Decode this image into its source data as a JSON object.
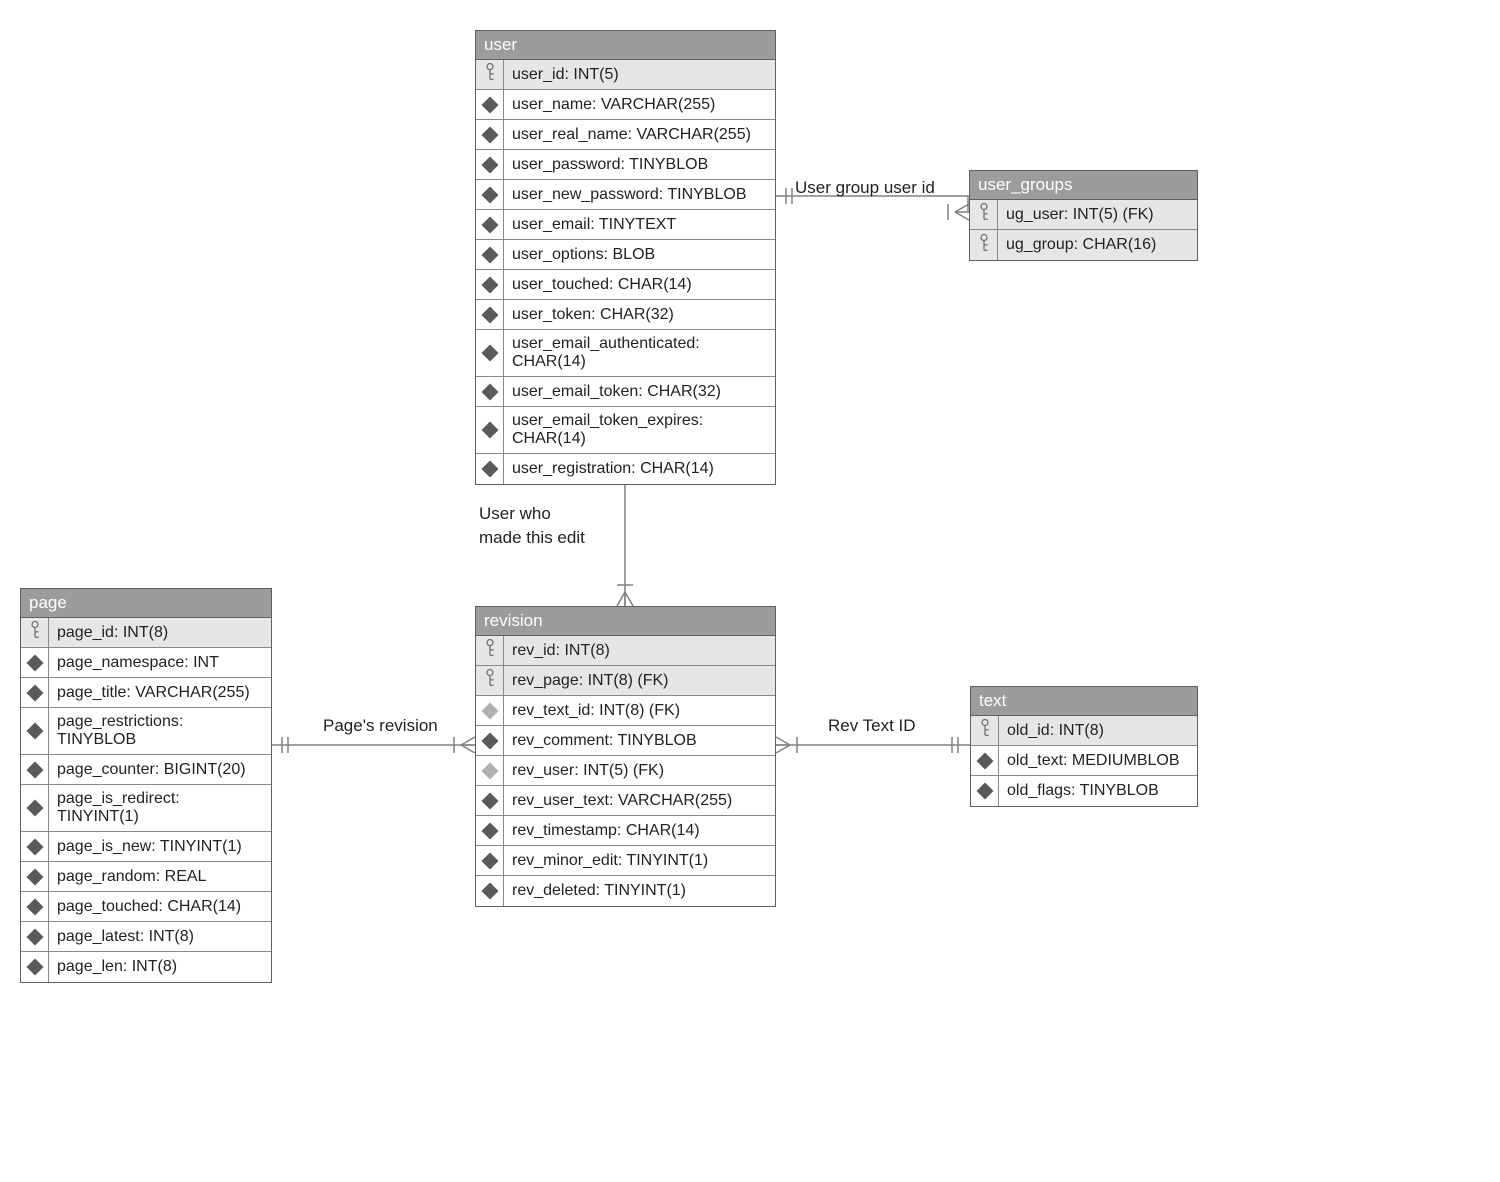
{
  "entities": {
    "user": {
      "title": "user",
      "fields": [
        {
          "name": "user_id: INT(5)",
          "pk": true
        },
        {
          "name": "user_name: VARCHAR(255)",
          "pk": false
        },
        {
          "name": "user_real_name: VARCHAR(255)",
          "pk": false
        },
        {
          "name": "user_password: TINYBLOB",
          "pk": false
        },
        {
          "name": "user_new_password: TINYBLOB",
          "pk": false
        },
        {
          "name": "user_email: TINYTEXT",
          "pk": false
        },
        {
          "name": "user_options: BLOB",
          "pk": false
        },
        {
          "name": "user_touched: CHAR(14)",
          "pk": false
        },
        {
          "name": "user_token: CHAR(32)",
          "pk": false
        },
        {
          "name": "user_email_authenticated: CHAR(14)",
          "pk": false
        },
        {
          "name": "user_email_token: CHAR(32)",
          "pk": false
        },
        {
          "name": "user_email_token_expires: CHAR(14)",
          "pk": false
        },
        {
          "name": "user_registration: CHAR(14)",
          "pk": false
        }
      ]
    },
    "user_groups": {
      "title": "user_groups",
      "fields": [
        {
          "name": "ug_user: INT(5) (FK)",
          "pk": true
        },
        {
          "name": "ug_group: CHAR(16)",
          "pk": true
        }
      ]
    },
    "page": {
      "title": "page",
      "fields": [
        {
          "name": "page_id: INT(8)",
          "pk": true
        },
        {
          "name": "page_namespace: INT",
          "pk": false
        },
        {
          "name": "page_title: VARCHAR(255)",
          "pk": false
        },
        {
          "name": "page_restrictions: TINYBLOB",
          "pk": false
        },
        {
          "name": "page_counter: BIGINT(20)",
          "pk": false
        },
        {
          "name": "page_is_redirect: TINYINT(1)",
          "pk": false
        },
        {
          "name": "page_is_new: TINYINT(1)",
          "pk": false
        },
        {
          "name": "page_random: REAL",
          "pk": false
        },
        {
          "name": "page_touched: CHAR(14)",
          "pk": false
        },
        {
          "name": "page_latest: INT(8)",
          "pk": false
        },
        {
          "name": "page_len: INT(8)",
          "pk": false
        }
      ]
    },
    "revision": {
      "title": "revision",
      "fields": [
        {
          "name": "rev_id: INT(8)",
          "pk": true
        },
        {
          "name": "rev_page: INT(8) (FK)",
          "pk": true
        },
        {
          "name": "rev_text_id: INT(8) (FK)",
          "pk": false,
          "light": true
        },
        {
          "name": "rev_comment: TINYBLOB",
          "pk": false
        },
        {
          "name": "rev_user: INT(5) (FK)",
          "pk": false,
          "light": true
        },
        {
          "name": "rev_user_text: VARCHAR(255)",
          "pk": false
        },
        {
          "name": "rev_timestamp: CHAR(14)",
          "pk": false
        },
        {
          "name": "rev_minor_edit: TINYINT(1)",
          "pk": false
        },
        {
          "name": "rev_deleted: TINYINT(1)",
          "pk": false
        }
      ]
    },
    "text": {
      "title": "text",
      "fields": [
        {
          "name": "old_id: INT(8)",
          "pk": true
        },
        {
          "name": "old_text: MEDIUMBLOB",
          "pk": false
        },
        {
          "name": "old_flags: TINYBLOB",
          "pk": false
        }
      ]
    }
  },
  "labels": {
    "user_groups_rel": "User group user id",
    "user_revision_rel_l1": "User who",
    "user_revision_rel_l2": "made this edit",
    "page_revision_rel": "Page's revision",
    "text_revision_rel": "Rev Text ID"
  }
}
